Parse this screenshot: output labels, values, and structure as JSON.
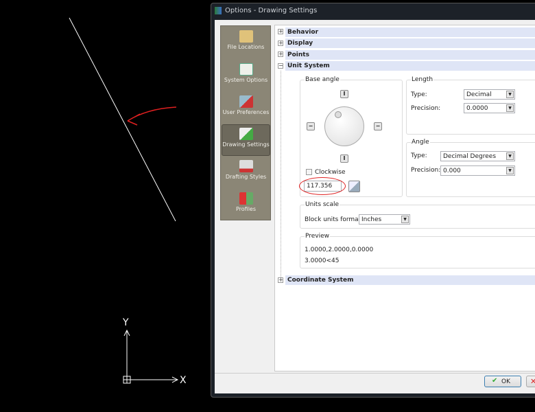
{
  "canvas": {
    "x_axis_label": "X",
    "y_axis_label": "Y",
    "annotation_color": "#e02020"
  },
  "window": {
    "title": "Options - Drawing Settings"
  },
  "sidebar": {
    "items": [
      {
        "label": "File Locations",
        "icon": "folder-arrow-icon",
        "selected": false
      },
      {
        "label": "System Options",
        "icon": "checklist-icon",
        "selected": false
      },
      {
        "label": "User Preferences",
        "icon": "user-preferences-icon",
        "selected": false
      },
      {
        "label": "Drawing Settings",
        "icon": "drawing-settings-icon",
        "selected": true
      },
      {
        "label": "Drafting Styles",
        "icon": "drafting-styles-icon",
        "selected": false
      },
      {
        "label": "Profiles",
        "icon": "profiles-icon",
        "selected": false
      }
    ]
  },
  "sections": {
    "behavior": "Behavior",
    "display": "Display",
    "points": "Points",
    "unit_system": "Unit System",
    "coordinate_system": "Coordinate System"
  },
  "base_angle": {
    "title": "Base angle",
    "clockwise_label": "Clockwise",
    "clockwise_checked": false,
    "value": "117.356"
  },
  "length": {
    "title": "Length",
    "type_label": "Type:",
    "type_value": "Decimal",
    "precision_label": "Precision:",
    "precision_value": "0.0000"
  },
  "angle": {
    "title": "Angle",
    "type_label": "Type:",
    "type_value": "Decimal Degrees",
    "precision_label": "Precision:",
    "precision_value": "0.000"
  },
  "units_scale": {
    "title": "Units scale",
    "block_units_label": "Block units format:",
    "block_units_value": "Inches"
  },
  "preview": {
    "title": "Preview",
    "line1": "1.0000,2.0000,0.0000",
    "line2": "3.0000<45"
  },
  "buttons": {
    "ok": "OK"
  }
}
